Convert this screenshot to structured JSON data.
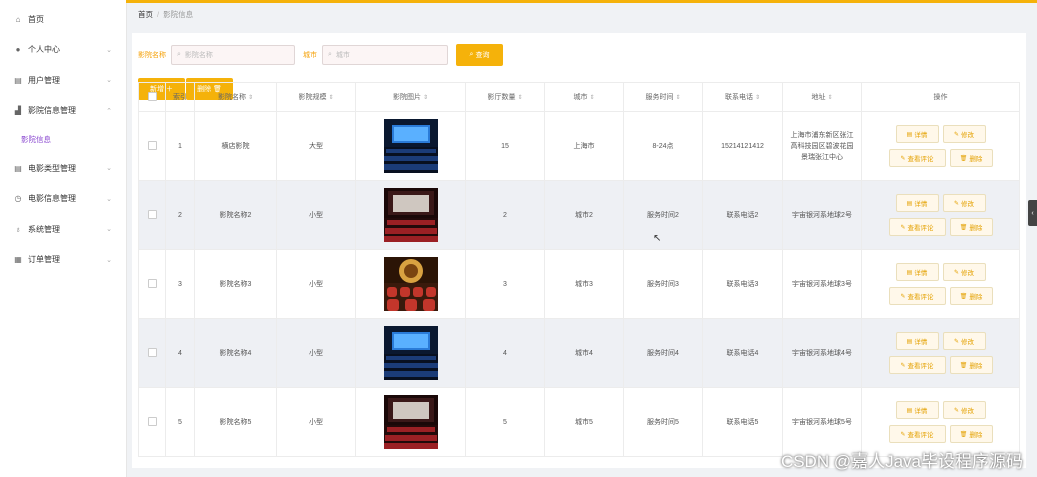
{
  "sidebar": {
    "items": [
      {
        "icon": "home-icon",
        "label": "首页",
        "chevron": false
      },
      {
        "icon": "user-icon",
        "label": "个人中心",
        "chevron": true
      },
      {
        "icon": "document-icon",
        "label": "用户管理",
        "chevron": true
      },
      {
        "icon": "chart-icon",
        "label": "影院信息管理",
        "chevron": true
      },
      {
        "icon": "document-icon",
        "label": "电影类型管理",
        "chevron": true
      },
      {
        "icon": "clock-icon",
        "label": "电影信息管理",
        "chevron": true
      },
      {
        "icon": "microphone-icon",
        "label": "系统管理",
        "chevron": true
      },
      {
        "icon": "shop-icon",
        "label": "订单管理",
        "chevron": true
      }
    ],
    "sub_item": "影院信息"
  },
  "breadcrumb": {
    "home": "首页",
    "separator": "/",
    "current": "影院信息"
  },
  "search": {
    "name_label": "影院名称",
    "name_placeholder": "影院名称",
    "city_label": "城市",
    "city_placeholder": "城市",
    "search_button": "查询"
  },
  "actions": {
    "add": "新增 ＋",
    "delete": "删除 🗑"
  },
  "table": {
    "headers": [
      "索引",
      "影院名称",
      "影院规模",
      "影院图片",
      "影厅数量",
      "城市",
      "服务时间",
      "联系电话",
      "地址",
      "操作"
    ],
    "rows": [
      {
        "index": "1",
        "name": "横店影院",
        "scale": "大型",
        "image": "cinema-seats-blue",
        "halls": "15",
        "city": "上海市",
        "hours": "8-24点",
        "phone": "15214121412",
        "address": "上海市浦东新区张江高科技园区碧波花园景瑞张江中心"
      },
      {
        "index": "2",
        "name": "影院名称2",
        "scale": "小型",
        "image": "cinema-seats-red",
        "halls": "2",
        "city": "城市2",
        "hours": "服务时间2",
        "phone": "联系电话2",
        "address": "宇宙银河系地球2号"
      },
      {
        "index": "3",
        "name": "影院名称3",
        "scale": "小型",
        "image": "cinema-theater-gold",
        "halls": "3",
        "city": "城市3",
        "hours": "服务时间3",
        "phone": "联系电话3",
        "address": "宇宙银河系地球3号"
      },
      {
        "index": "4",
        "name": "影院名称4",
        "scale": "小型",
        "image": "cinema-seats-blue",
        "halls": "4",
        "city": "城市4",
        "hours": "服务时间4",
        "phone": "联系电话4",
        "address": "宇宙银河系地球4号"
      },
      {
        "index": "5",
        "name": "影院名称5",
        "scale": "小型",
        "image": "cinema-seats-red",
        "halls": "5",
        "city": "城市5",
        "hours": "服务时间5",
        "phone": "联系电话5",
        "address": "宇宙银河系地球5号"
      }
    ],
    "op_buttons": {
      "detail": "详情",
      "edit": "修改",
      "reviews": "查看评论",
      "delete": "删除"
    }
  },
  "watermark": "CSDN @嘉人Java毕设程序源码",
  "colors": {
    "accent": "#f5b20a",
    "submenu": "#8c4bd1"
  }
}
